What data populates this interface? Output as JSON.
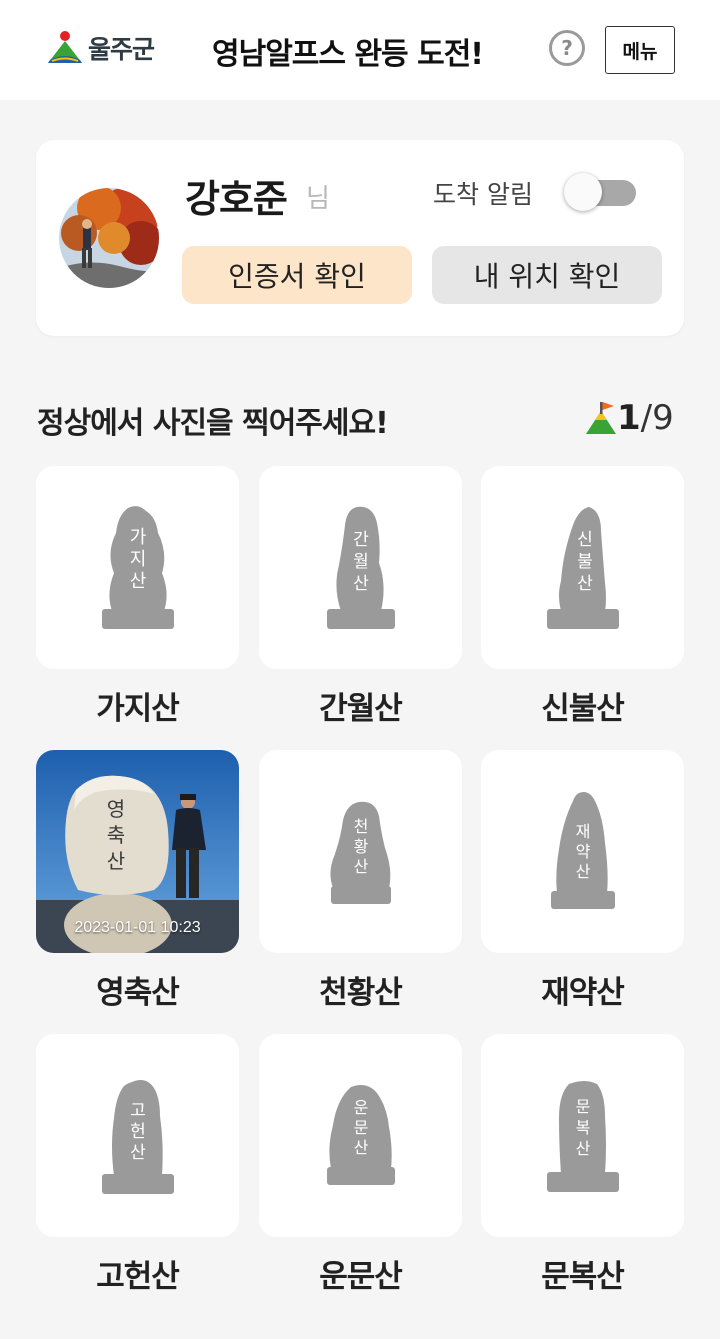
{
  "header": {
    "logo_text": "울주군",
    "title": "영남알프스 완등 도전!",
    "help_label": "?",
    "menu_label": "메뉴"
  },
  "profile": {
    "name": "강호준",
    "suffix": "님",
    "arrival_alert_label": "도착 알림",
    "arrival_alert_on": false,
    "certificate_button": "인증서 확인",
    "location_button": "내 위치 확인"
  },
  "challenge": {
    "prompt": "정상에서 사진을 찍어주세요!",
    "completed": "1",
    "separator": "/",
    "total": "9"
  },
  "mountains": [
    {
      "name": "가지산",
      "stone_text": [
        "가",
        "지",
        "산"
      ],
      "photo_taken": false
    },
    {
      "name": "간월산",
      "stone_text": [
        "간",
        "월",
        "산"
      ],
      "photo_taken": false
    },
    {
      "name": "신불산",
      "stone_text": [
        "신",
        "불",
        "산"
      ],
      "photo_taken": false
    },
    {
      "name": "영축산",
      "stone_text": [
        "영",
        "축",
        "산"
      ],
      "photo_taken": true,
      "photo_date": "2023-01-01 10:23"
    },
    {
      "name": "천황산",
      "stone_text": [
        "천",
        "황",
        "산"
      ],
      "photo_taken": false
    },
    {
      "name": "재약산",
      "stone_text": [
        "재",
        "약",
        "산"
      ],
      "photo_taken": false
    },
    {
      "name": "고헌산",
      "stone_text": [
        "고",
        "헌",
        "산"
      ],
      "photo_taken": false
    },
    {
      "name": "운문산",
      "stone_text": [
        "운",
        "문",
        "산"
      ],
      "photo_taken": false
    },
    {
      "name": "문복산",
      "stone_text": [
        "문",
        "복",
        "산"
      ],
      "photo_taken": false
    }
  ],
  "colors": {
    "certificate_button_bg": "#fde5c9",
    "location_button_bg": "#e6e6e6",
    "stone_gray": "#9a9a9a",
    "toggle_off": "#a8a8a8"
  },
  "icons": {
    "logo": "ulju-mountain-logo-icon",
    "progress": "summit-flag-icon",
    "help": "question-circle-icon"
  }
}
